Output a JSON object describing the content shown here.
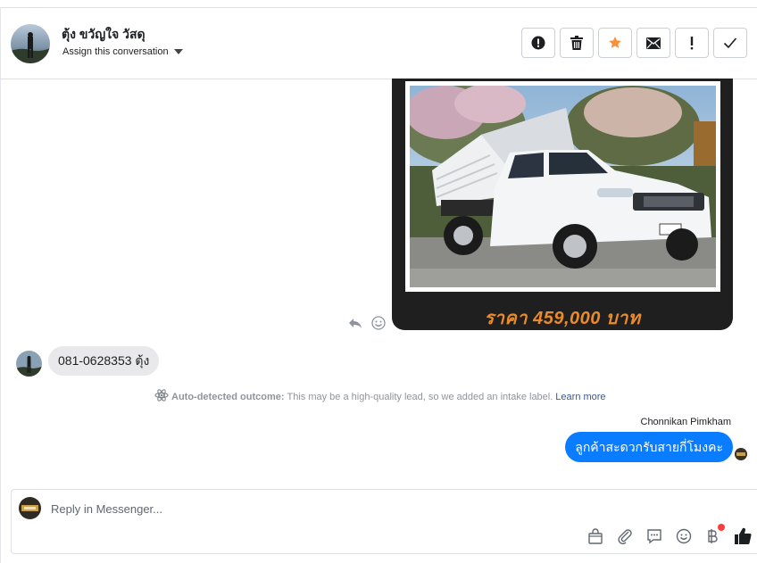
{
  "header": {
    "contact_name": "ตุ้ง ขวัญใจ วัสดุ",
    "assign_label": "Assign this conversation",
    "actions": [
      "report-icon",
      "trash-icon",
      "star-icon",
      "envelope-icon",
      "exclamation-icon",
      "check-icon"
    ]
  },
  "attachment": {
    "price_text": "ราคา 459,000 บาท",
    "tools": [
      "reply-icon",
      "emoji-icon"
    ]
  },
  "messages": {
    "incoming_text": "081-0628353 ตุ้ง",
    "notice_title": "Auto-detected outcome:",
    "notice_body": "This may be a high-quality lead, so we added an intake label.",
    "notice_link": "Learn more",
    "sender_name": "Chonnikan Pimkham",
    "outgoing_text": "ลูกค้าสะดวกรับสายกี่โมงคะ"
  },
  "composer": {
    "placeholder": "Reply in Messenger...",
    "tools": [
      "shopping-bag-icon",
      "paperclip-icon",
      "saved-replies-icon",
      "emoji-icon",
      "baht-payment-icon",
      "like-icon"
    ]
  },
  "colors": {
    "accent": "#0a7cff",
    "star": "#f7923b",
    "price": "#e98a2c",
    "notification_dot": "#fa3e3e"
  }
}
